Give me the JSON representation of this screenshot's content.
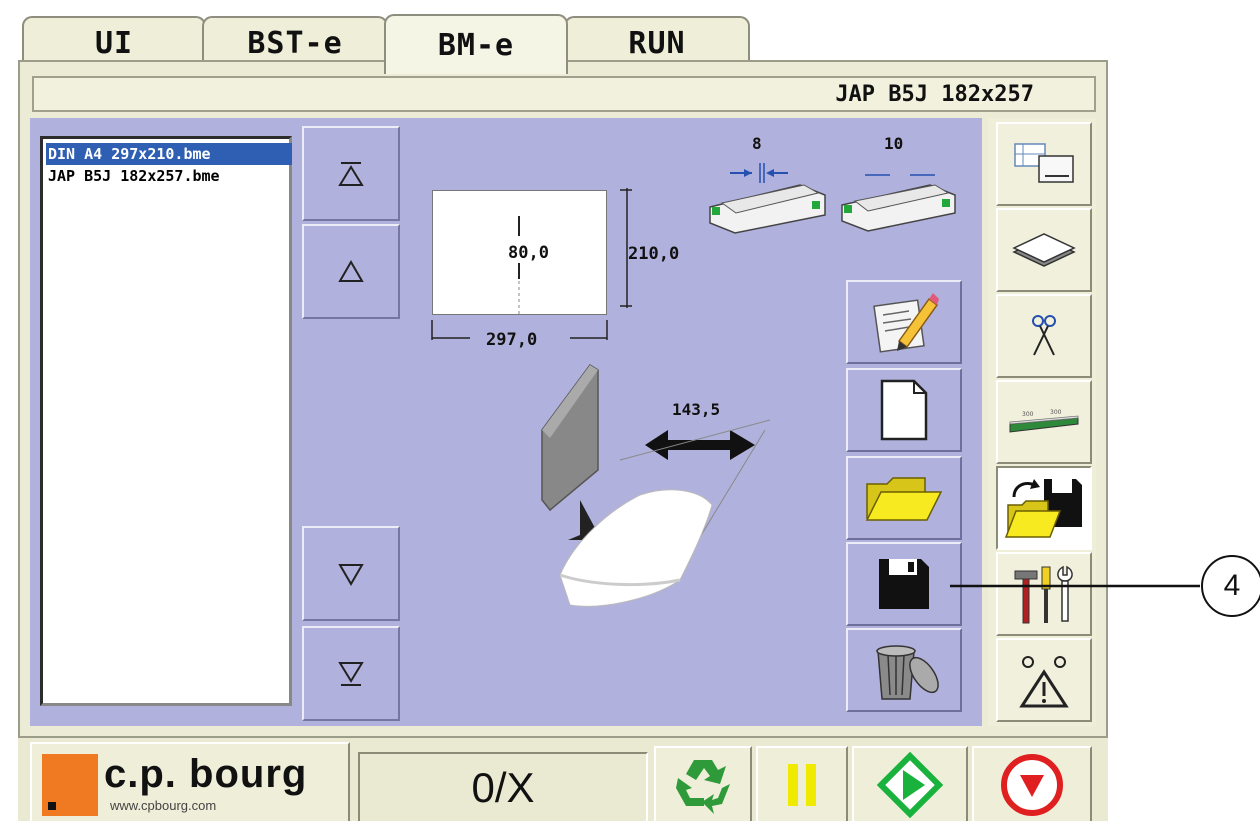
{
  "tabs": [
    {
      "label": "UI"
    },
    {
      "label": "BST-e"
    },
    {
      "label": "BM-e"
    },
    {
      "label": "RUN"
    }
  ],
  "active_tab": "BM-e",
  "header": {
    "title": "JAP B5J 182x257"
  },
  "file_list": {
    "items": [
      {
        "label": "DIN A4 297x210.bme",
        "selected": true
      },
      {
        "label": "JAP B5J 182x257.bme",
        "selected": false
      }
    ]
  },
  "nav_buttons": {
    "first": "top-arrow",
    "up": "up-arrow",
    "down": "down-arrow",
    "last": "bottom-arrow"
  },
  "diagram": {
    "height_value": "80,0",
    "sheet_height": "210,0",
    "sheet_width": "297,0",
    "tray_left_value": "8",
    "tray_right_value": "10",
    "transport_value": "143,5"
  },
  "actions": [
    {
      "icon": "edit-document-icon"
    },
    {
      "icon": "new-document-icon"
    },
    {
      "icon": "open-folder-icon"
    },
    {
      "icon": "save-floppy-icon"
    },
    {
      "icon": "trash-icon"
    }
  ],
  "sidebar": [
    {
      "icon": "layout-settings-icon"
    },
    {
      "icon": "paper-stack-icon"
    },
    {
      "icon": "cut-marks-icon"
    },
    {
      "icon": "stapler-icon"
    },
    {
      "icon": "open-save-icon",
      "active": true
    },
    {
      "icon": "tools-icon"
    },
    {
      "icon": "warning-sensors-icon"
    }
  ],
  "callout": {
    "number": "4"
  },
  "bottom": {
    "brand": "c.p. bourg",
    "brand_url": "www.cpbourg.com",
    "counter": "0/X"
  },
  "colors": {
    "canvas": "#b1b1dd",
    "frame": "#ececd6",
    "selection": "#2f5fb2",
    "recycle_green": "#2e9a3a",
    "pause_yellow": "#f0ea00",
    "start_green": "#18b23c",
    "stop_red": "#e02020",
    "brand_orange": "#f07a22"
  }
}
